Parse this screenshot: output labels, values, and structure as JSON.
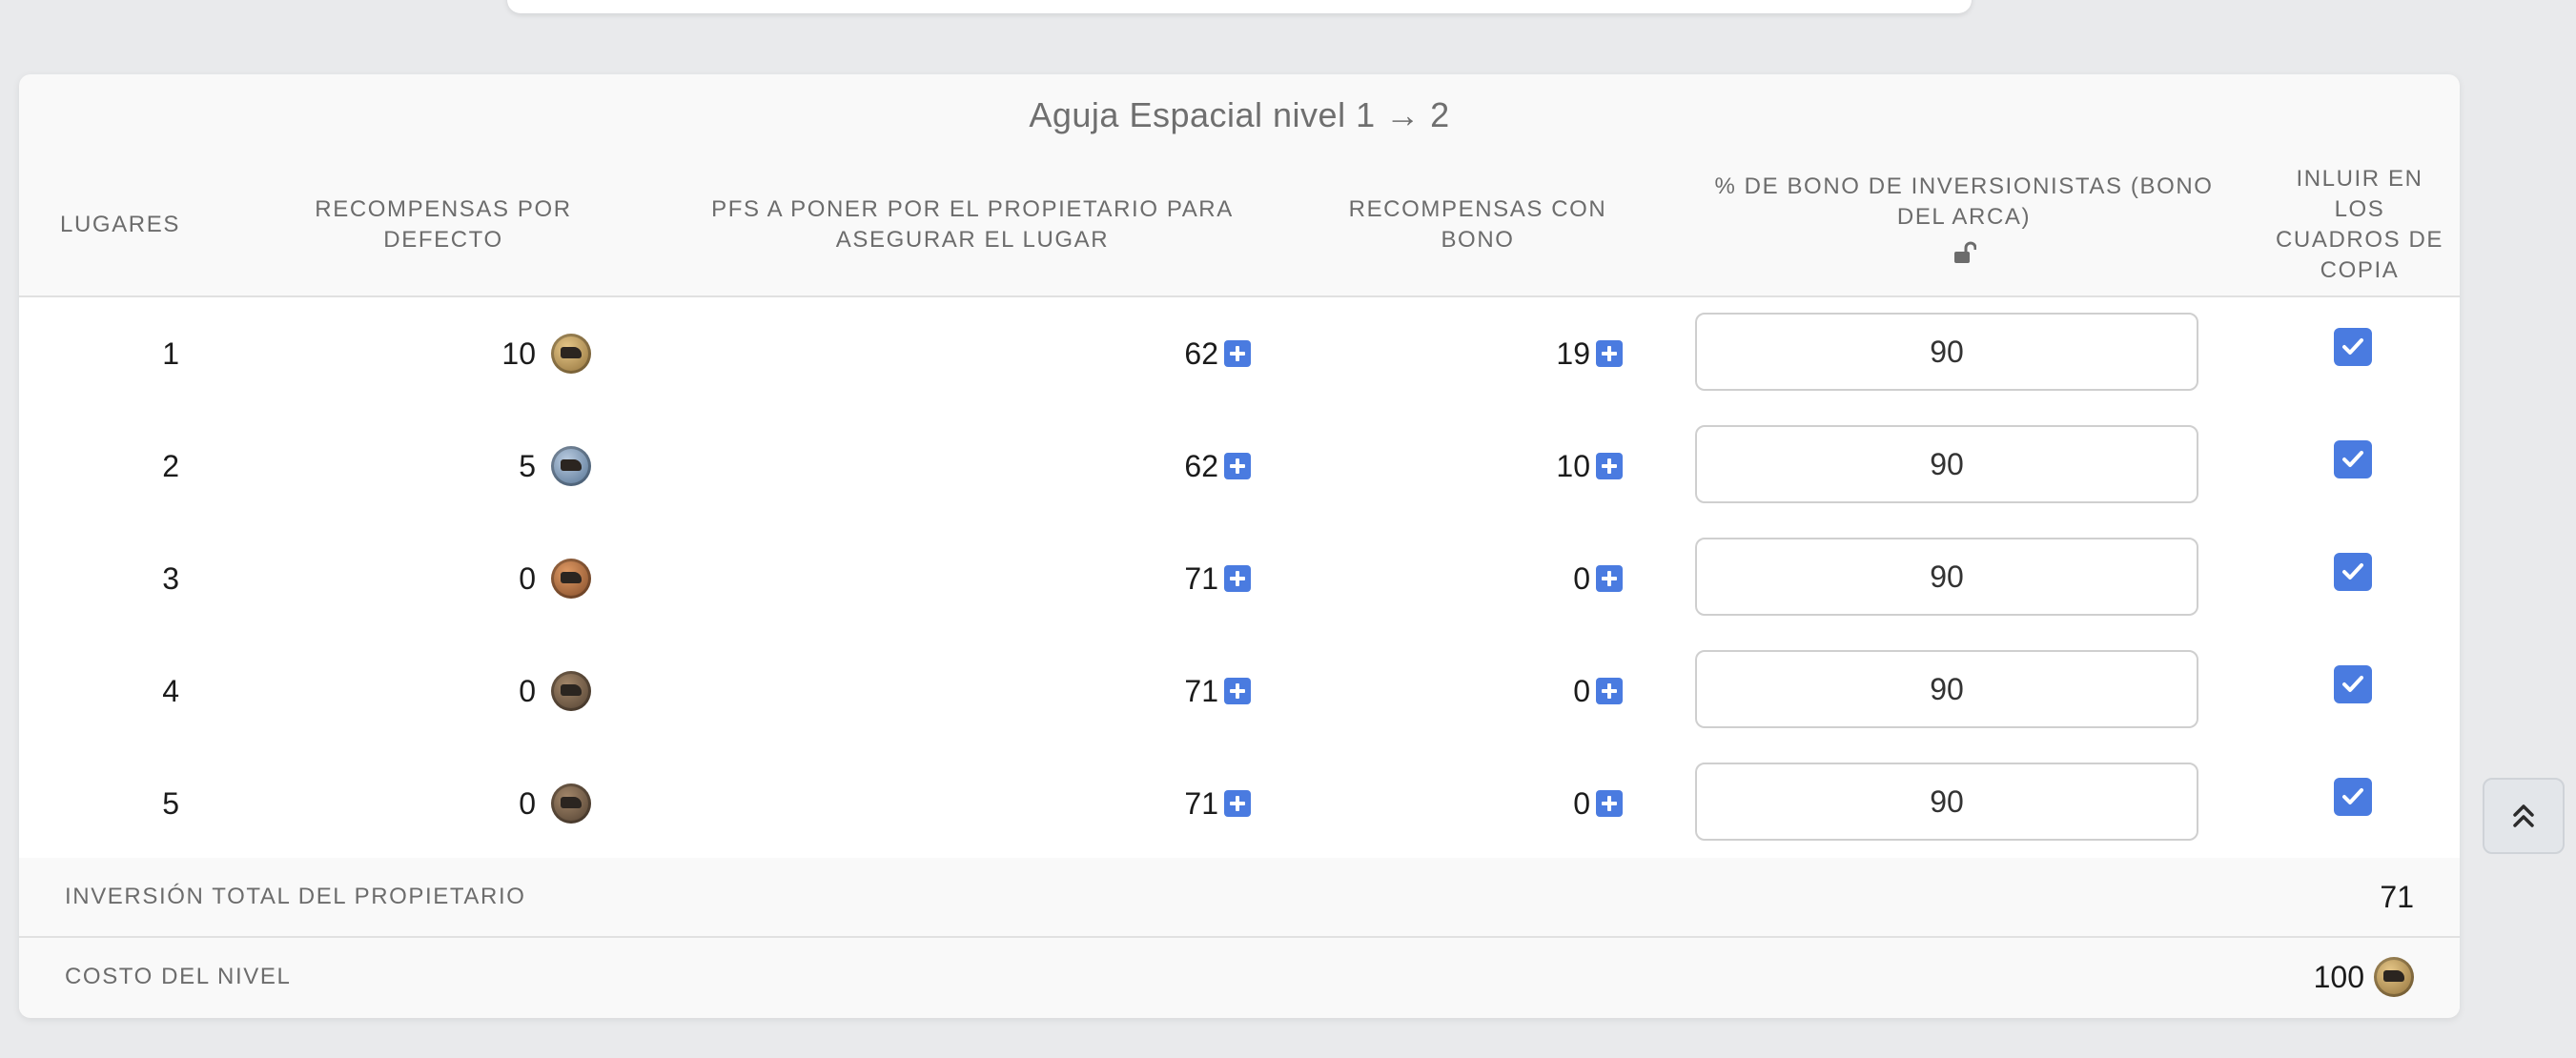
{
  "title": "Aguja Espacial nivel 1 → 2",
  "columns": {
    "places": "LUGARES",
    "default_rewards": "RECOMPENSAS POR DEFECTO",
    "owner_fps": "PFS A PONER POR EL PROPIETARIO PARA ASEGURAR EL LUGAR",
    "bonus_rewards": "RECOMPENSAS CON BONO",
    "investor_bonus": "% DE BONO DE INVERSIONISTAS (BONO DEL ARCA)",
    "include_copy": "INLUIR EN LOS CUADROS DE COPIA"
  },
  "rows": [
    {
      "place": "1",
      "default_reward": "10",
      "medal": "gold-medal-icon",
      "owner_fps": "62",
      "bonus_reward": "19",
      "bonus_pct": "90",
      "checked": true
    },
    {
      "place": "2",
      "default_reward": "5",
      "medal": "silver-medal-icon",
      "owner_fps": "62",
      "bonus_reward": "10",
      "bonus_pct": "90",
      "checked": true
    },
    {
      "place": "3",
      "default_reward": "0",
      "medal": "bronze-medal-icon",
      "owner_fps": "71",
      "bonus_reward": "0",
      "bonus_pct": "90",
      "checked": true
    },
    {
      "place": "4",
      "default_reward": "0",
      "medal": "dark-medal-icon",
      "owner_fps": "71",
      "bonus_reward": "0",
      "bonus_pct": "90",
      "checked": true
    },
    {
      "place": "5",
      "default_reward": "0",
      "medal": "dark-medal-icon",
      "owner_fps": "71",
      "bonus_reward": "0",
      "bonus_pct": "90",
      "checked": true
    }
  ],
  "footer": {
    "total_label": "INVERSIÓN TOTAL DEL PROPIETARIO",
    "total_value": "71",
    "cost_label": "COSTO DEL NIVEL",
    "cost_value": "100"
  },
  "colors": {
    "accent": "#4a7be0",
    "header_text": "#6c6c6c",
    "background": "#e9eaec"
  }
}
